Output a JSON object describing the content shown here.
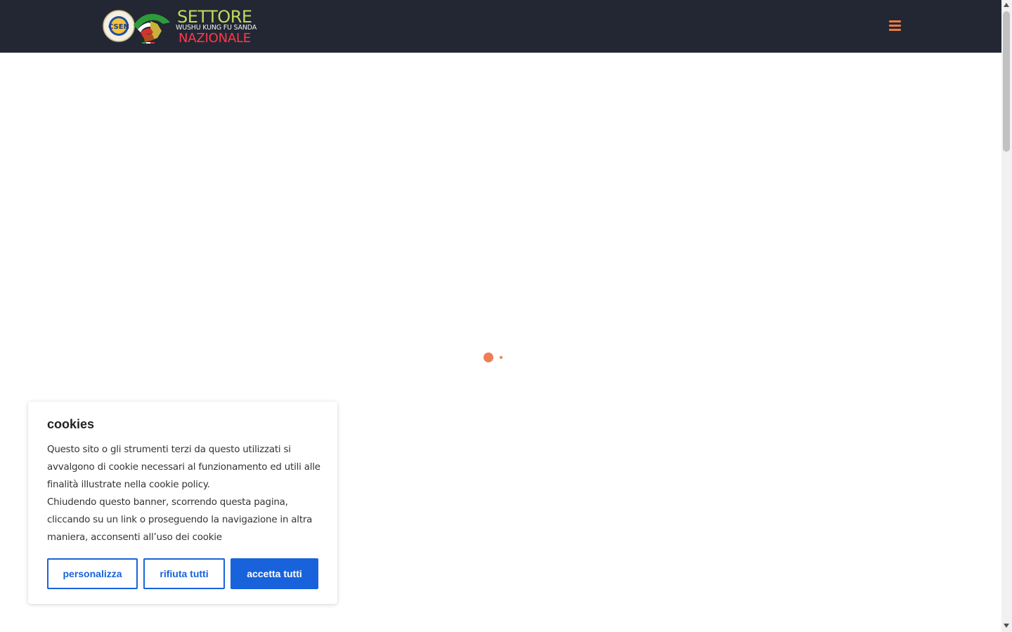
{
  "header": {
    "logo": {
      "seal_text": "CSEN",
      "line1": "SETTORE",
      "line2": "WUSHU KUNG FU SANDA",
      "line3": "NAZIONALE"
    },
    "menu_icon": "hamburger-menu-icon",
    "background_color": "#222733",
    "accent_color": "#f07a3d"
  },
  "loader": {
    "color": "#ef7d55"
  },
  "cookie_banner": {
    "title": "cookies",
    "paragraph1": "Questo sito o gli strumenti terzi da questo utilizzati si avvalgono di cookie necessari al funzionamento ed utili alle finalità illustrate nella cookie policy.",
    "paragraph2": "Chiudendo questo banner, scorrendo questa pagina, cliccando su un link o proseguendo la navigazione in altra maniera, acconsenti all’uso dei cookie",
    "buttons": {
      "customize": "personalizza",
      "reject_all": "rifiuta tutti",
      "accept_all": "accetta tutti"
    },
    "button_color": "#1863dc"
  }
}
